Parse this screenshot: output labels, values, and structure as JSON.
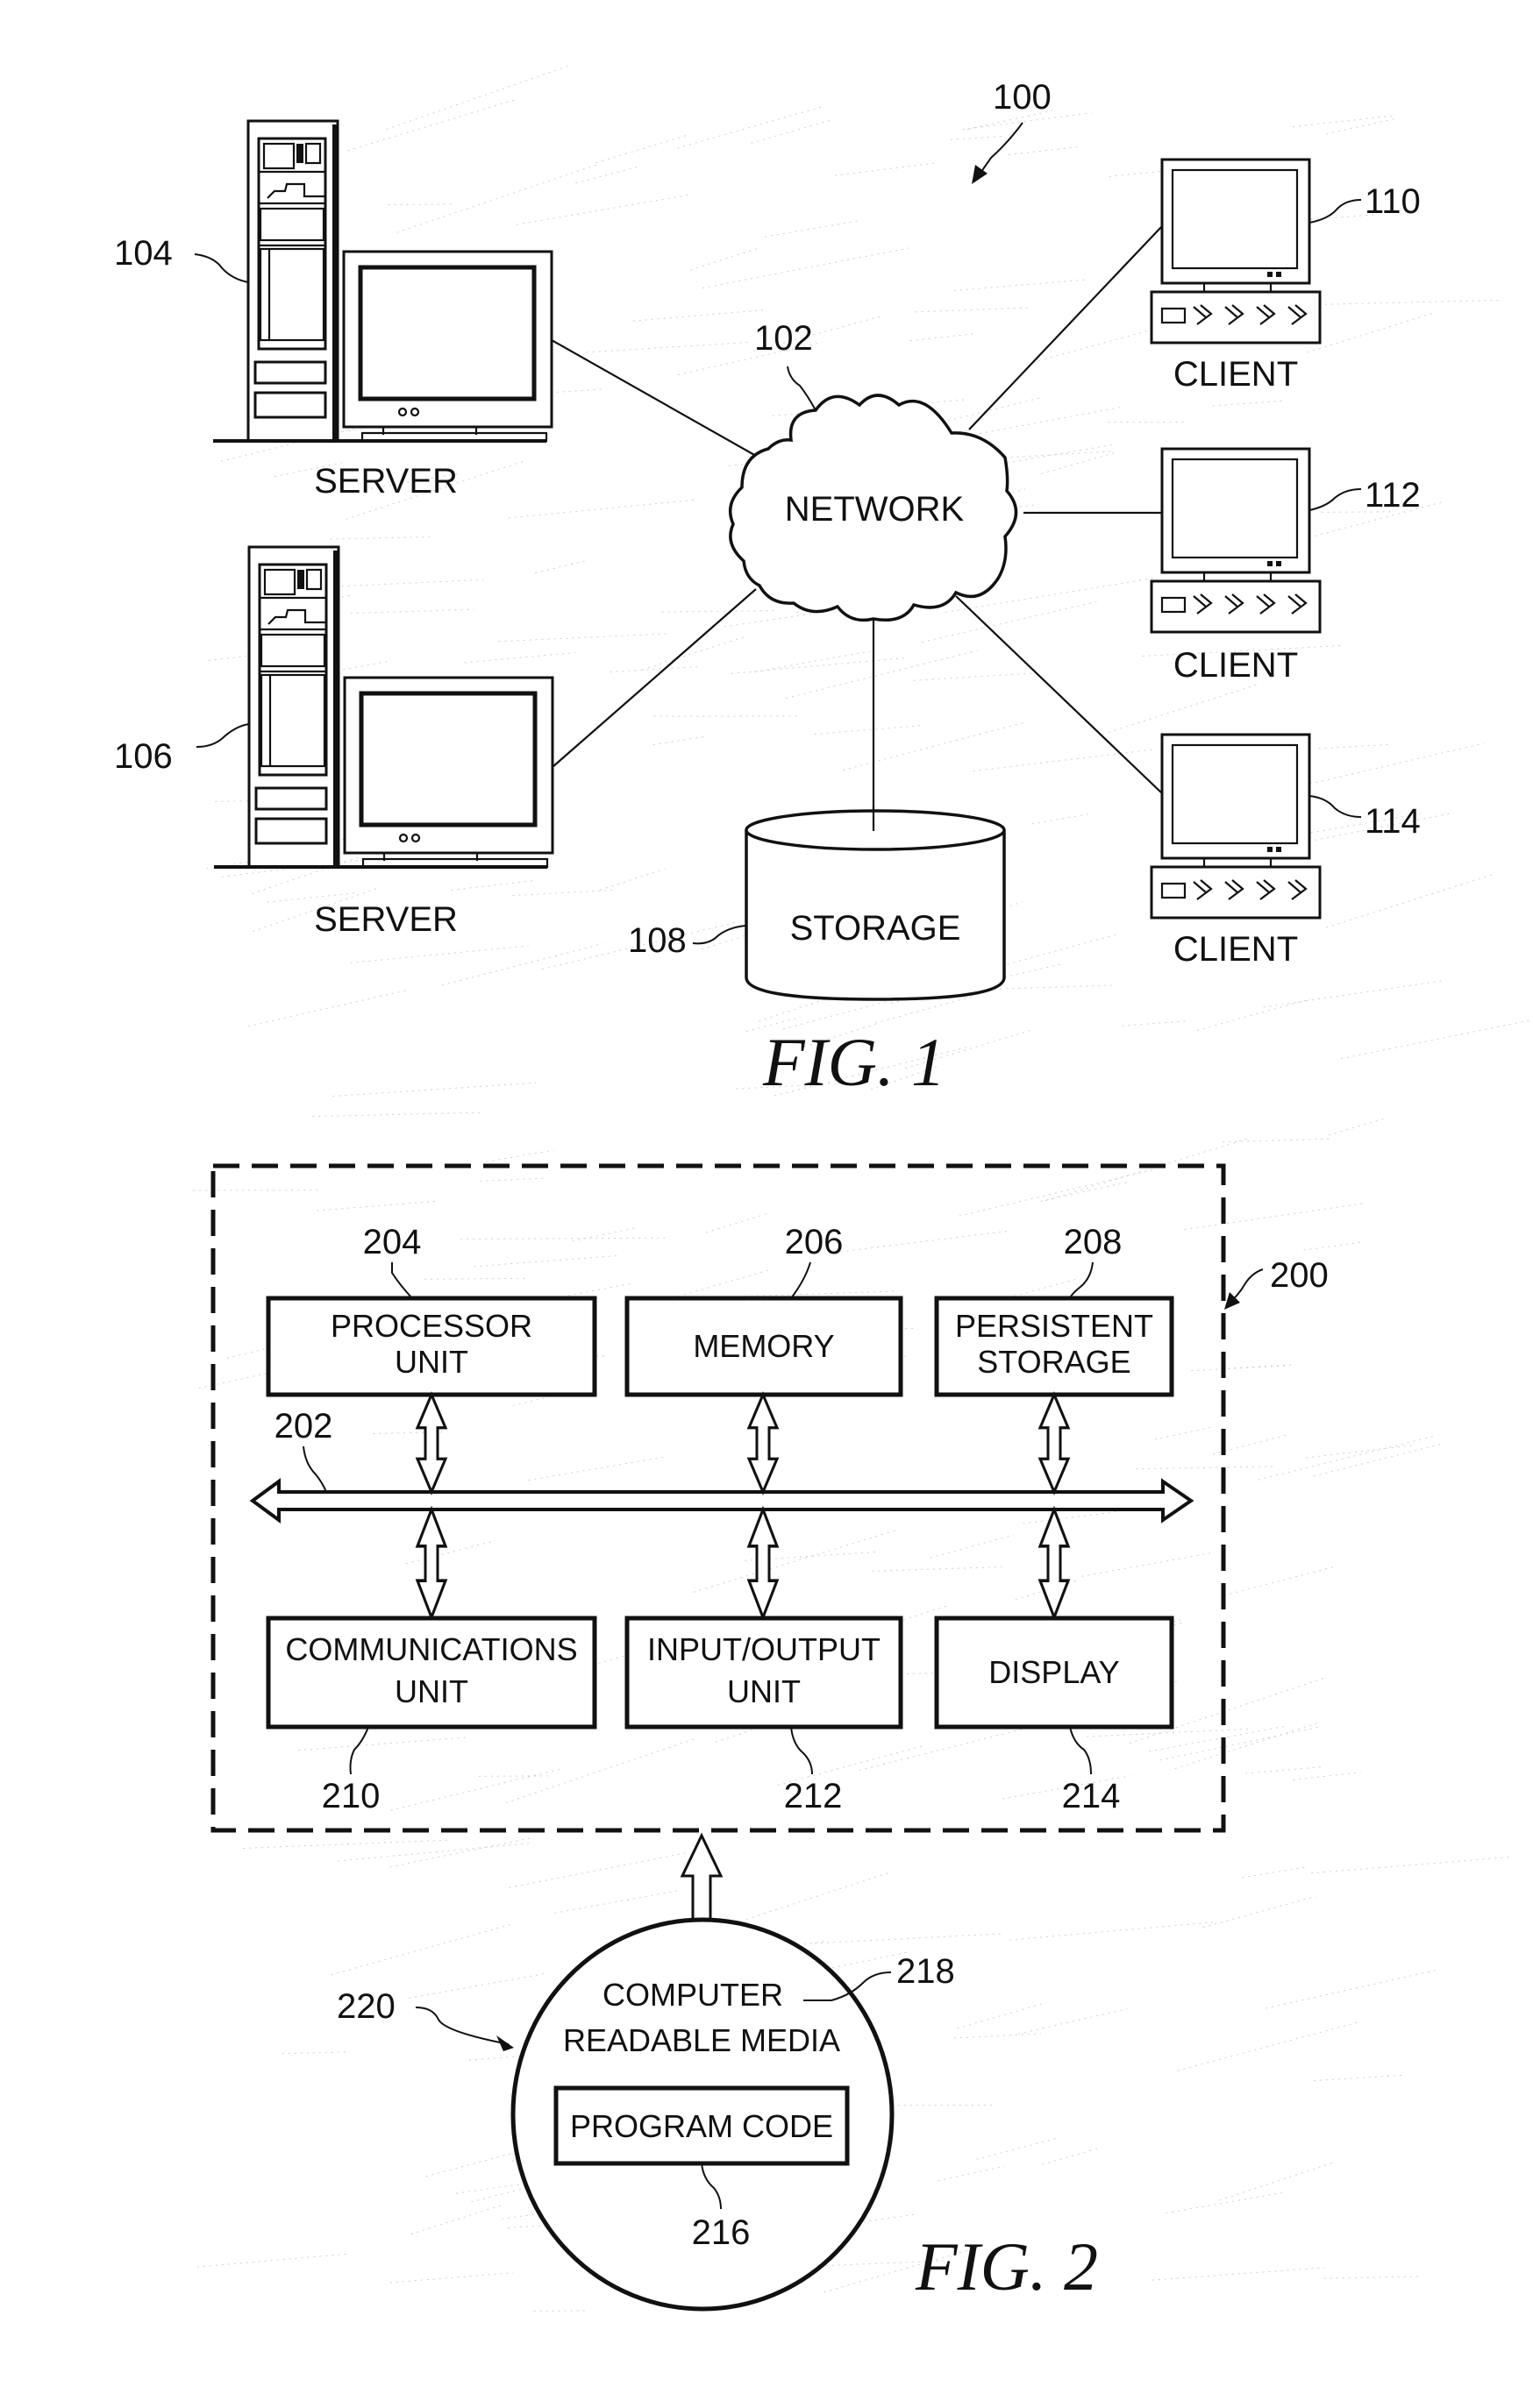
{
  "figure1": {
    "caption": "FIG. 1",
    "system_ref": "100",
    "network": {
      "label": "NETWORK",
      "ref": "102"
    },
    "servers": [
      {
        "label": "SERVER",
        "ref": "104"
      },
      {
        "label": "SERVER",
        "ref": "106"
      }
    ],
    "storage": {
      "label": "STORAGE",
      "ref": "108"
    },
    "clients": [
      {
        "label": "CLIENT",
        "ref": "110"
      },
      {
        "label": "CLIENT",
        "ref": "112"
      },
      {
        "label": "CLIENT",
        "ref": "114"
      }
    ]
  },
  "figure2": {
    "caption": "FIG. 2",
    "system_ref": "200",
    "bus_ref": "202",
    "top_row": [
      {
        "line1": "PROCESSOR",
        "line2": "UNIT",
        "ref": "204"
      },
      {
        "line1": "MEMORY",
        "line2": "",
        "ref": "206"
      },
      {
        "line1": "PERSISTENT",
        "line2": "STORAGE",
        "ref": "208"
      }
    ],
    "bottom_row": [
      {
        "line1": "COMMUNICATIONS",
        "line2": "UNIT",
        "ref": "210"
      },
      {
        "line1": "INPUT/OUTPUT",
        "line2": "UNIT",
        "ref": "212"
      },
      {
        "line1": "DISPLAY",
        "line2": "",
        "ref": "214"
      }
    ],
    "media": {
      "line1": "COMPUTER",
      "line2": "READABLE MEDIA",
      "media_ref": "218",
      "product_ref": "220",
      "program_code": {
        "label": "PROGRAM CODE",
        "ref": "216"
      }
    }
  }
}
